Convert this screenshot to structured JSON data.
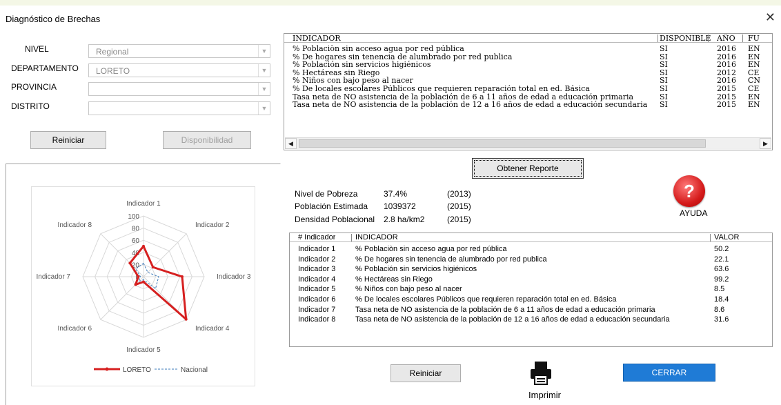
{
  "window": {
    "title": "Diagnóstico de Brechas",
    "close_glyph": "✕"
  },
  "filters": {
    "nivel": {
      "label": "NIVEL",
      "value": "Regional"
    },
    "departamento": {
      "label": "DEPARTAMENTO",
      "value": "LORETO"
    },
    "provincia": {
      "label": "PROVINCIA",
      "value": ""
    },
    "distrito": {
      "label": "DISTRITO",
      "value": ""
    }
  },
  "buttons": {
    "reiniciar_top": "Reiniciar",
    "disponibilidad": "Disponibilidad",
    "obtener_reporte": "Obtener Reporte",
    "ayuda": "AYUDA",
    "ayuda_glyph": "?",
    "reiniciar_bottom": "Reiniciar",
    "cerrar": "CERRAR",
    "imprimir": "Imprimir"
  },
  "availability_table": {
    "columns": [
      "INDICADOR",
      "DISPONIBLE",
      "AÑO",
      "FU"
    ],
    "rows": [
      {
        "indicador": "% Poblaciòn sin acceso agua por red pública",
        "disponible": "SI",
        "anio": "2016",
        "fu": "EN"
      },
      {
        "indicador": "% De hogares sin tenencia de alumbrado por red publica",
        "disponible": "SI",
        "anio": "2016",
        "fu": "EN"
      },
      {
        "indicador": "% Población sin servicios higiénicos",
        "disponible": "SI",
        "anio": "2016",
        "fu": "EN"
      },
      {
        "indicador": "% Hectáreas sin Riego",
        "disponible": "SI",
        "anio": "2012",
        "fu": "CE"
      },
      {
        "indicador": "% Niños con bajo peso al nacer",
        "disponible": "SI",
        "anio": "2016",
        "fu": "CN"
      },
      {
        "indicador": "% De locales escolares Públicos que requieren reparación total en ed. Básica",
        "disponible": "SI",
        "anio": "2015",
        "fu": "CE"
      },
      {
        "indicador": "Tasa neta de NO asistencia de la población de 6 a 11 años de edad a educación primaria",
        "disponible": "SI",
        "anio": "2015",
        "fu": "EN"
      },
      {
        "indicador": "Tasa neta de NO asistencia de la población de 12 a 16 años de edad a educación secundaria",
        "disponible": "SI",
        "anio": "2015",
        "fu": "EN"
      }
    ]
  },
  "summary": {
    "pobreza": {
      "label": "Nivel de Pobreza",
      "value": "37.4%",
      "year": "(2013)"
    },
    "poblacion": {
      "label": "Población Estimada",
      "value": "1039372",
      "year": "(2015)"
    },
    "densidad": {
      "label": "Densidad Poblacional",
      "value": "2.8 ha/km2",
      "year": "(2015)"
    }
  },
  "results_table": {
    "columns": [
      "# Indicador",
      "INDICADOR",
      "VALOR"
    ],
    "rows": [
      {
        "num": "Indicador 1",
        "indicador": "% Poblaciòn sin acceso agua por red pública",
        "valor": "50.2"
      },
      {
        "num": "Indicador 2",
        "indicador": "% De hogares sin tenencia de alumbrado por red publica",
        "valor": "22.1"
      },
      {
        "num": "Indicador 3",
        "indicador": "% Población sin servicios higiénicos",
        "valor": "63.6"
      },
      {
        "num": "Indicador 4",
        "indicador": "% Hectáreas sin Riego",
        "valor": "99.2"
      },
      {
        "num": "Indicador 5",
        "indicador": "% Niños con bajo peso al nacer",
        "valor": "8.5"
      },
      {
        "num": "Indicador 6",
        "indicador": "% De locales escolares Públicos que requieren reparación total en ed. Básica",
        "valor": "18.4"
      },
      {
        "num": "Indicador 7",
        "indicador": "Tasa neta de NO asistencia de la población de 6 a 11 años de edad a educación primaria",
        "valor": "8.6"
      },
      {
        "num": "Indicador 8",
        "indicador": "Tasa neta de NO asistencia de la población de 12 a 16 años de edad a educación secundaria",
        "valor": "31.6"
      }
    ]
  },
  "colors": {
    "loreto": "#d62020",
    "nacional": "#3a78b8",
    "cerrar": "#1f7bd6",
    "help": "#d51c1c"
  },
  "icons": {
    "help": "question-circle-icon",
    "print": "printer-icon",
    "close": "close-icon",
    "dropdown": "chevron-down-icon"
  },
  "chart_data": {
    "type": "radar",
    "categories": [
      "Indicador 1",
      "Indicador 2",
      "Indicador 3",
      "Indicador 4",
      "Indicador 5",
      "Indicador 6",
      "Indicador 7",
      "Indicador 8"
    ],
    "ticks": [
      "0",
      "20",
      "40",
      "60",
      "80",
      "100"
    ],
    "ylim": [
      0,
      100
    ],
    "series": [
      {
        "name": "LORETO",
        "values": [
          50.2,
          22.1,
          63.6,
          99.2,
          8.5,
          18.4,
          8.6,
          31.6
        ]
      },
      {
        "name": "Nacional",
        "values": [
          22,
          10,
          25,
          28,
          5,
          11,
          5,
          18
        ]
      }
    ],
    "legend": "bottom"
  }
}
